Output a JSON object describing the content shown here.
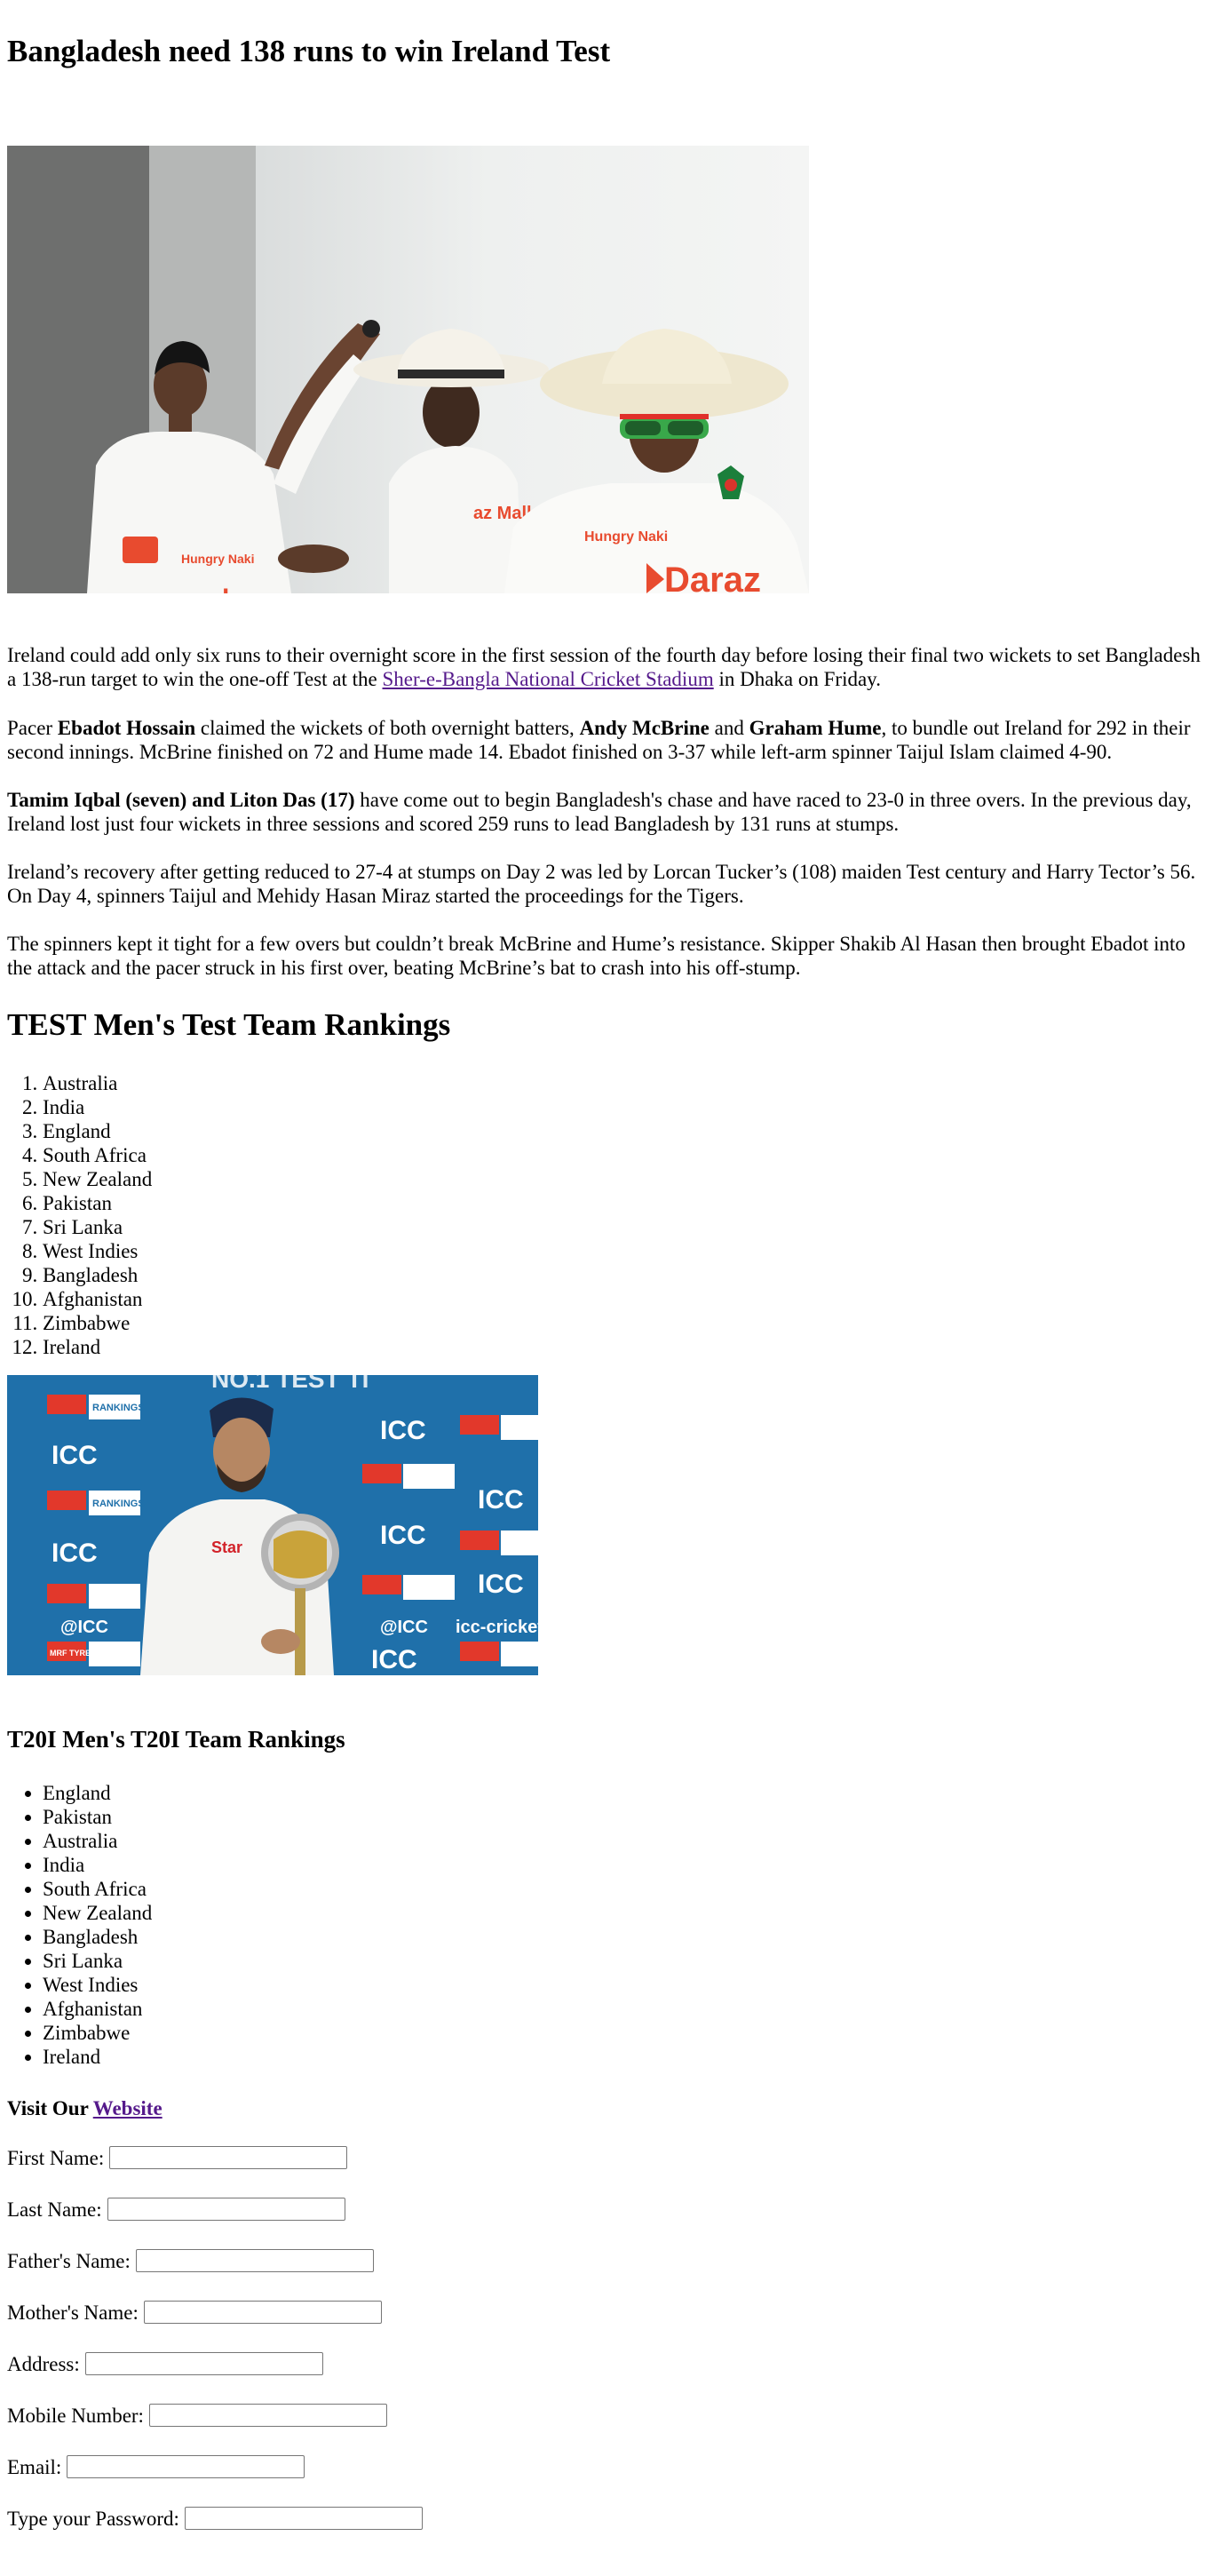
{
  "article": {
    "headline": "Bangladesh need 138 runs to win Ireland Test",
    "p1_before": "Ireland could add only six runs to their overnight score in the first session of the fourth day before losing their final two wickets to set Bangladesh a 138-run target to win the one-off Test at the ",
    "p1_link": "Sher-e-Bangla National Cricket Stadium",
    "p1_after": " in Dhaka on Friday.",
    "p2_a": "Pacer ",
    "p2_b": "Ebadot Hossain",
    "p2_c": " claimed the wickets of both overnight batters, ",
    "p2_d": "Andy McBrine",
    "p2_e": " and ",
    "p2_f": "Graham Hume",
    "p2_g": ", to bundle out Ireland for 292 in their second innings. McBrine finished on 72 and Hume made 14. Ebadot finished on 3-37 while left-arm spinner Taijul Islam claimed 4-90.",
    "p3_bold": "Tamim Iqbal (seven) and Liton Das (17)",
    "p3_rest": " have come out to begin Bangladesh's chase and have raced to 23-0 in three overs. In the previous day, Ireland lost just four wickets in three sessions and scored 259 runs to lead Bangladesh by 131 runs at stumps.",
    "p4": "Ireland’s recovery after getting reduced to 27-4 at stumps on Day 2 was led by Lorcan Tucker’s (108) maiden Test century and Harry Tector’s 56. On Day 4, spinners Taijul and Mehidy Hasan Miraz started the proceedings for the Tigers.",
    "p5": "The spinners kept it tight for a few overs but couldn’t break McBrine and Hume’s resistance. Skipper Shakib Al Hasan then brought Ebadot into the attack and the pacer struck in his first over, beating McBrine’s bat to crash into his off-stump."
  },
  "photo1": {
    "jersey_text_1": "Hungry Naki",
    "jersey_text_2": "Daraz",
    "jersey_text_3": "Hungry Naki",
    "jersey_text_4": "daraz",
    "jersey_text_5": "az Mall"
  },
  "test_rankings": {
    "heading": "TEST Men's Test Team Rankings",
    "teams": [
      "Australia",
      "India",
      "England",
      "South Africa",
      "New Zealand",
      "Pakistan",
      "Sri Lanka",
      "West Indies",
      "Bangladesh",
      "Afghanistan",
      "Zimbabwe",
      "Ireland"
    ]
  },
  "photo2": {
    "banner_text": "NO.1 TEST TI",
    "icc": "ICC",
    "rankings": "RANKINGS",
    "handle": "@ICC",
    "site": "icc-cricket.c",
    "mrf": "MRF TYRES",
    "star": "Star"
  },
  "t20i_rankings": {
    "heading": "T20I Men's T20I Team Rankings",
    "teams": [
      "England",
      "Pakistan",
      "Australia",
      "India",
      "South Africa",
      "New Zealand",
      "Bangladesh",
      "Sri Lanka",
      "West Indies",
      "Afghanistan",
      "Zimbabwe",
      "Ireland"
    ]
  },
  "visit": {
    "prefix": "Visit Our ",
    "link": "Website"
  },
  "form": {
    "first_name": "First Name:",
    "last_name": "Last Name:",
    "father_name": "Father's Name:",
    "mother_name": "Mother's Name:",
    "address": "Address:",
    "mobile": "Mobile Number:",
    "email": "Email:",
    "password": "Type your Password:"
  },
  "colors": {
    "link": "#551a8b",
    "text": "#000000",
    "icc_blue": "#1c6ea7",
    "daraz_orange": "#f36a3a"
  }
}
